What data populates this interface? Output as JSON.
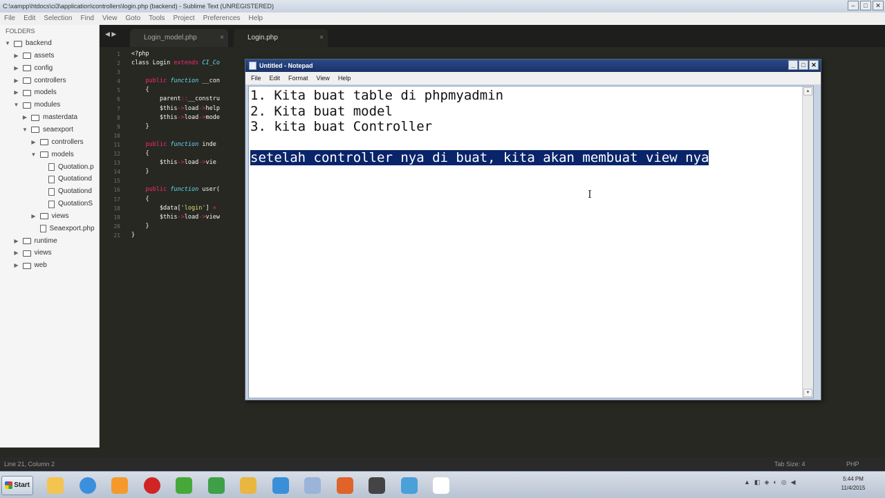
{
  "window_title": "C:\\xampp\\htdocs\\ci3\\application\\controllers\\login.php (backend) - Sublime Text (UNREGISTERED)",
  "menu": [
    "File",
    "Edit",
    "Selection",
    "Find",
    "View",
    "Goto",
    "Tools",
    "Project",
    "Preferences",
    "Help"
  ],
  "sidebar": {
    "header": "FOLDERS",
    "items": [
      {
        "label": "backend",
        "depth": 0,
        "type": "folder",
        "open": true
      },
      {
        "label": "assets",
        "depth": 1,
        "type": "folder"
      },
      {
        "label": "config",
        "depth": 1,
        "type": "folder"
      },
      {
        "label": "controllers",
        "depth": 1,
        "type": "folder"
      },
      {
        "label": "models",
        "depth": 1,
        "type": "folder"
      },
      {
        "label": "modules",
        "depth": 1,
        "type": "folder",
        "open": true
      },
      {
        "label": "masterdata",
        "depth": 2,
        "type": "folder"
      },
      {
        "label": "seaexport",
        "depth": 2,
        "type": "folder",
        "open": true
      },
      {
        "label": "controllers",
        "depth": 3,
        "type": "folder"
      },
      {
        "label": "models",
        "depth": 3,
        "type": "folder",
        "open": true
      },
      {
        "label": "Quotation.p",
        "depth": 4,
        "type": "file"
      },
      {
        "label": "Quotationd",
        "depth": 4,
        "type": "file"
      },
      {
        "label": "Quotationd",
        "depth": 4,
        "type": "file"
      },
      {
        "label": "QuotationS",
        "depth": 4,
        "type": "file"
      },
      {
        "label": "views",
        "depth": 3,
        "type": "folder"
      },
      {
        "label": "Seaexport.php",
        "depth": 3,
        "type": "file"
      },
      {
        "label": "runtime",
        "depth": 1,
        "type": "folder"
      },
      {
        "label": "views",
        "depth": 1,
        "type": "folder"
      },
      {
        "label": "web",
        "depth": 1,
        "type": "folder"
      }
    ]
  },
  "tabs": [
    {
      "label": "Login_model.php",
      "active": false
    },
    {
      "label": "Login.php",
      "active": true
    }
  ],
  "code_lines": [
    "1",
    "2",
    "3",
    "4",
    "5",
    "6",
    "7",
    "8",
    "9",
    "10",
    "11",
    "12",
    "13",
    "14",
    "15",
    "16",
    "17",
    "18",
    "19",
    "20",
    "21"
  ],
  "status": {
    "left": "Line 21, Column 2",
    "tab_size": "Tab Size: 4",
    "syntax": "PHP"
  },
  "notepad": {
    "title": "Untitled - Notepad",
    "menu": [
      "File",
      "Edit",
      "Format",
      "View",
      "Help"
    ],
    "lines": [
      "1. Kita buat table di phpmyadmin",
      "2. Kita buat model",
      "3. kita buat Controller",
      ""
    ],
    "selected_line": "setelah controller nya di buat, kita akan membuat view nya"
  },
  "taskbar": {
    "start_label": "Start",
    "clock_time": "5:44 PM",
    "clock_date": "11/4/2015",
    "icons": [
      "explorer-icon",
      "chrome-icon",
      "media-player-icon",
      "opera-icon",
      "network-icon",
      "paint-icon",
      "mail-icon",
      "installer-icon",
      "folder-icon",
      "xampp-icon",
      "sublime-icon",
      "notepad-icon",
      "window-icon"
    ],
    "icon_colors": [
      "#f4c451",
      "#3c8fdd",
      "#f59a2a",
      "#d12424",
      "#47a83a",
      "#3fa047",
      "#e9b640",
      "#3b8fd8",
      "#9bb4d8",
      "#e0632a",
      "#444444",
      "#4aa0d8",
      "#ffffff"
    ]
  },
  "accent": {
    "selection": "#0a246a",
    "notepad_title": "#1a3268"
  }
}
